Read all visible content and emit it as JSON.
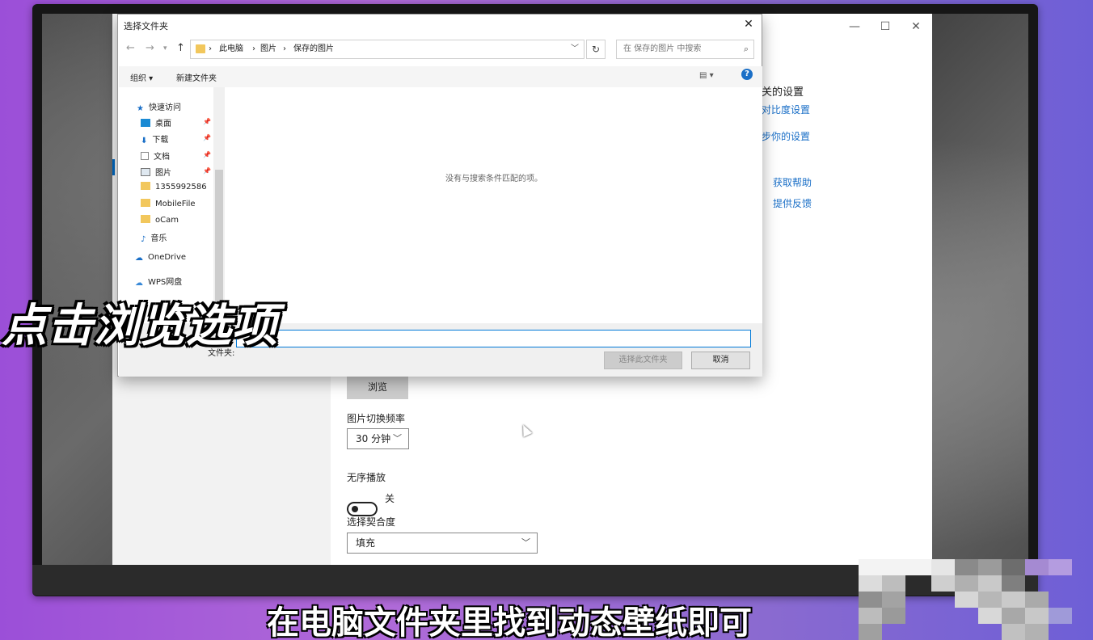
{
  "settings": {
    "window_controls": [
      "—",
      "☐",
      "✕"
    ],
    "related_heading": "关的设置",
    "related_links": [
      "对比度设置",
      "步你的设置"
    ],
    "help_links": [
      "获取帮助",
      "提供反馈"
    ],
    "browse_label": "浏览",
    "interval_label": "图片切换频率",
    "interval_value": "30 分钟",
    "shuffle_label": "无序播放",
    "shuffle_state": "关",
    "fit_label": "选择契合度",
    "fit_value": "填充"
  },
  "dialog": {
    "title": "选择文件夹",
    "close": "✕",
    "breadcrumb": [
      "此电脑",
      "图片",
      "保存的图片"
    ],
    "search_placeholder": "在 保存的图片 中搜索",
    "toolbar": {
      "organize": "组织 ▾",
      "new_folder": "新建文件夹",
      "help": "?"
    },
    "tree": [
      {
        "label": "快速访问",
        "icon": "star-icon",
        "pinned": false
      },
      {
        "label": "桌面",
        "icon": "desktop-icon",
        "pinned": true
      },
      {
        "label": "下载",
        "icon": "download-icon",
        "pinned": true
      },
      {
        "label": "文档",
        "icon": "document-icon",
        "pinned": true
      },
      {
        "label": "图片",
        "icon": "picture-icon",
        "pinned": true
      },
      {
        "label": "1355992586",
        "icon": "folder-icon",
        "pinned": false
      },
      {
        "label": "MobileFile",
        "icon": "folder-icon",
        "pinned": false
      },
      {
        "label": "oCam",
        "icon": "folder-icon",
        "pinned": false
      },
      {
        "label": "音乐",
        "icon": "music-icon",
        "pinned": false
      },
      {
        "label": "OneDrive",
        "icon": "cloud-icon",
        "pinned": false
      },
      {
        "label": "WPS网盘",
        "icon": "cloud-icon",
        "pinned": false
      }
    ],
    "empty_message": "没有与搜索条件匹配的项。",
    "folder_field_label": "文件夹:",
    "folder_field_value": "",
    "select_button": "选择此文件夹",
    "cancel_button": "取消"
  },
  "overlay": {
    "headline": "点击浏览选项",
    "subtitle": "在电脑文件夹里找到动态壁纸即可"
  },
  "colors": {
    "accent": "#0067c0",
    "link": "#1a6fc7",
    "folder": "#f2c75c"
  }
}
